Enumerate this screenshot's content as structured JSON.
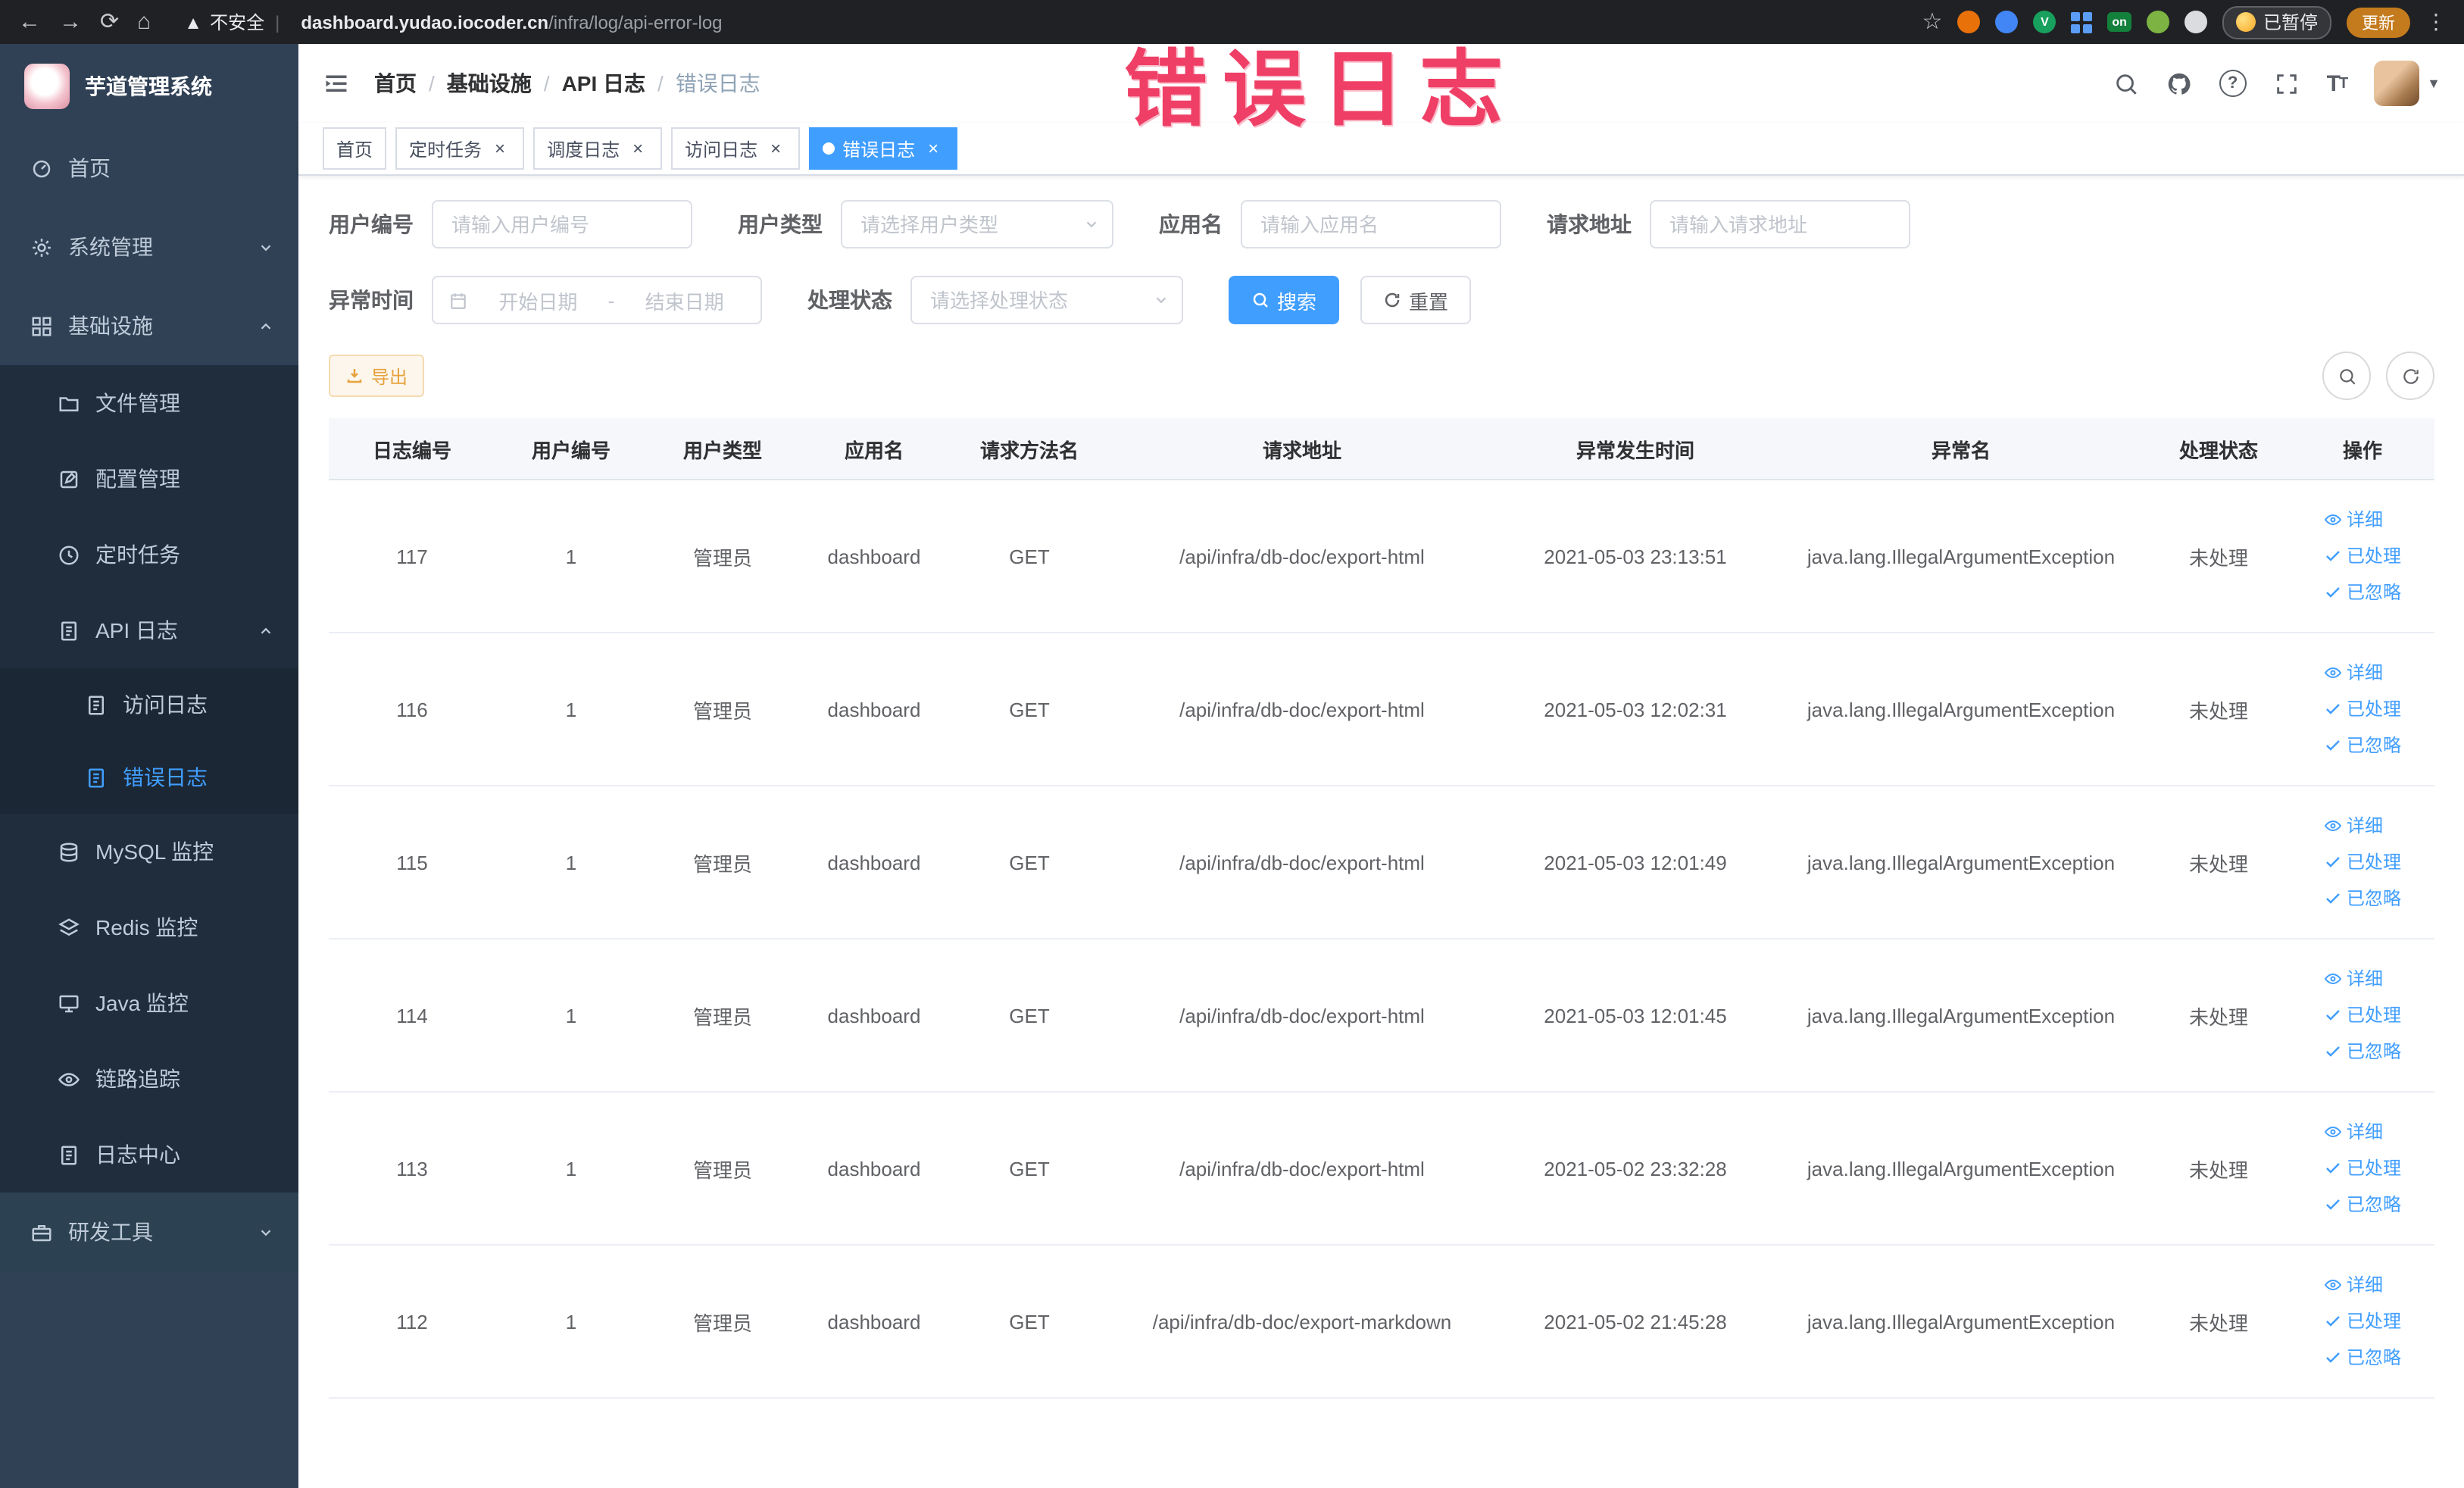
{
  "colors": {
    "primary": "#409eff",
    "annotation": "#ef3f66",
    "warning": "#e6a23c",
    "sidebar_bg": "#304156",
    "submenu_bg": "#1f2d3d"
  },
  "annotation": {
    "text": "错误日志"
  },
  "browser": {
    "security_label": "不安全",
    "url_domain": "dashboard.yudao.iocoder.cn",
    "url_path": "/infra/log/api-error-log",
    "ext_on": "on",
    "paused_label": "已暂停",
    "update_label": "更新"
  },
  "sidebar": {
    "title": "芋道管理系统",
    "items": [
      {
        "label": "首页"
      },
      {
        "label": "系统管理"
      },
      {
        "label": "基础设施"
      },
      {
        "label": "文件管理"
      },
      {
        "label": "配置管理"
      },
      {
        "label": "定时任务"
      },
      {
        "label": "API 日志"
      },
      {
        "label": "访问日志"
      },
      {
        "label": "错误日志"
      },
      {
        "label": "MySQL 监控"
      },
      {
        "label": "Redis 监控"
      },
      {
        "label": "Java 监控"
      },
      {
        "label": "链路追踪"
      },
      {
        "label": "日志中心"
      },
      {
        "label": "研发工具"
      }
    ]
  },
  "breadcrumb": {
    "items": [
      "首页",
      "基础设施",
      "API 日志",
      "错误日志"
    ]
  },
  "tabs": [
    {
      "label": "首页"
    },
    {
      "label": "定时任务"
    },
    {
      "label": "调度日志"
    },
    {
      "label": "访问日志"
    },
    {
      "label": "错误日志"
    }
  ],
  "filters": {
    "user_id_label": "用户编号",
    "user_id_placeholder": "请输入用户编号",
    "user_type_label": "用户类型",
    "user_type_placeholder": "请选择用户类型",
    "app_name_label": "应用名",
    "app_name_placeholder": "请输入应用名",
    "request_url_label": "请求地址",
    "request_url_placeholder": "请输入请求地址",
    "time_label": "异常时间",
    "time_start_placeholder": "开始日期",
    "time_separator": "-",
    "time_end_placeholder": "结束日期",
    "status_label": "处理状态",
    "status_placeholder": "请选择处理状态",
    "search_label": "搜索",
    "reset_label": "重置"
  },
  "toolbar": {
    "export_label": "导出"
  },
  "table": {
    "columns": [
      "日志编号",
      "用户编号",
      "用户类型",
      "应用名",
      "请求方法名",
      "请求地址",
      "异常发生时间",
      "异常名",
      "处理状态",
      "操作"
    ],
    "actions": {
      "detail": "详细",
      "processed": "已处理",
      "ignored": "已忽略"
    },
    "rows": [
      {
        "log_id": "117",
        "user_id": "1",
        "user_type": "管理员",
        "app_name": "dashboard",
        "method": "GET",
        "url": "/api/infra/db-doc/export-html",
        "time": "2021-05-03 23:13:51",
        "exception": "java.lang.IllegalArgumentException",
        "status": "未处理"
      },
      {
        "log_id": "116",
        "user_id": "1",
        "user_type": "管理员",
        "app_name": "dashboard",
        "method": "GET",
        "url": "/api/infra/db-doc/export-html",
        "time": "2021-05-03 12:02:31",
        "exception": "java.lang.IllegalArgumentException",
        "status": "未处理"
      },
      {
        "log_id": "115",
        "user_id": "1",
        "user_type": "管理员",
        "app_name": "dashboard",
        "method": "GET",
        "url": "/api/infra/db-doc/export-html",
        "time": "2021-05-03 12:01:49",
        "exception": "java.lang.IllegalArgumentException",
        "status": "未处理"
      },
      {
        "log_id": "114",
        "user_id": "1",
        "user_type": "管理员",
        "app_name": "dashboard",
        "method": "GET",
        "url": "/api/infra/db-doc/export-html",
        "time": "2021-05-03 12:01:45",
        "exception": "java.lang.IllegalArgumentException",
        "status": "未处理"
      },
      {
        "log_id": "113",
        "user_id": "1",
        "user_type": "管理员",
        "app_name": "dashboard",
        "method": "GET",
        "url": "/api/infra/db-doc/export-html",
        "time": "2021-05-02 23:32:28",
        "exception": "java.lang.IllegalArgumentException",
        "status": "未处理"
      },
      {
        "log_id": "112",
        "user_id": "1",
        "user_type": "管理员",
        "app_name": "dashboard",
        "method": "GET",
        "url": "/api/infra/db-doc/export-markdown",
        "time": "2021-05-02 21:45:28",
        "exception": "java.lang.IllegalArgumentException",
        "status": "未处理"
      }
    ]
  }
}
